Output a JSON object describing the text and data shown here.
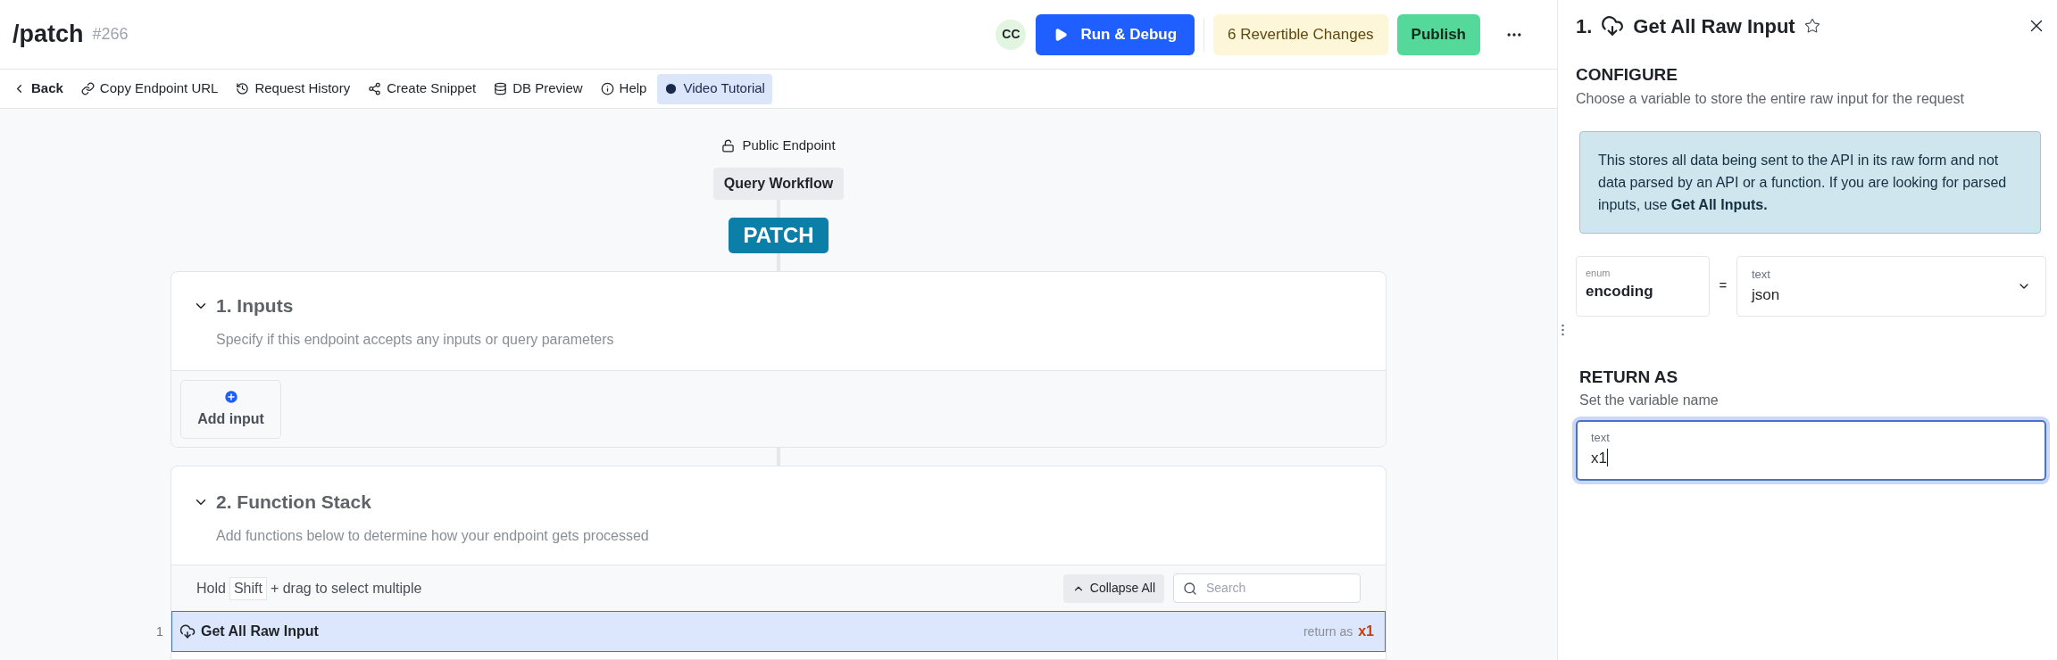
{
  "header": {
    "title": "/patch",
    "number": "#266",
    "avatar": "CC",
    "run_button": "Run & Debug",
    "changes_button": "6 Revertible Changes",
    "publish_button": "Publish"
  },
  "toolbar": [
    {
      "label": "Back",
      "selected": false
    },
    {
      "label": "Copy Endpoint URL",
      "selected": false
    },
    {
      "label": "Request History",
      "selected": false
    },
    {
      "label": "Create Snippet",
      "selected": false
    },
    {
      "label": "DB Preview",
      "selected": false
    },
    {
      "label": "Help",
      "selected": false
    },
    {
      "label": "Video Tutorial",
      "selected": true
    }
  ],
  "canvas": {
    "access": "Public Endpoint",
    "workflow": "Query Workflow",
    "method": "PATCH",
    "inputs": {
      "title": "1. Inputs",
      "description": "Specify if this endpoint accepts any inputs or query parameters",
      "expanded": true,
      "add_button": "Add input"
    },
    "function_stack": {
      "title": "2. Function Stack",
      "description": "Add functions below to determine how your endpoint gets processed",
      "expanded": true,
      "hint_before": "Hold",
      "hint_key": "Shift",
      "hint_after": "+ drag to select multiple",
      "collapse_button": "Collapse All",
      "search_placeholder": "Search",
      "steps": [
        {
          "index": "1",
          "name": "Get All Raw Input",
          "return_label": "return as",
          "return_var": "x1",
          "selected": true
        }
      ]
    }
  },
  "panel": {
    "step_number": "1.",
    "title": "Get All Raw Input",
    "starred": false,
    "configure_heading": "CONFIGURE",
    "configure_description": "Choose a variable to store the entire raw input for the request",
    "note": "This stores all data being sent to the API in its raw form and not data parsed by an API or a function. If you are looking for parsed inputs, use **Get All Inputs.**",
    "param": {
      "type_label": "enum",
      "name": "encoding",
      "operator": "=",
      "value_type": "text",
      "value": "json"
    },
    "return_heading": "RETURN AS",
    "return_description": "Set the variable name",
    "return_field": {
      "label": "text",
      "value": "x1",
      "focused": true
    }
  }
}
